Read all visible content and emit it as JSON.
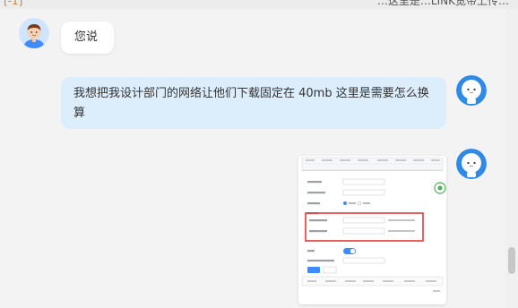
{
  "header": {
    "left_mark": "[-1]",
    "right_text": "…这里是…LINK宽带上传…"
  },
  "messages": [
    {
      "sender": "user",
      "text": "您说"
    },
    {
      "sender": "bot",
      "text": "我想把我设计部门的网络让他们下载固定在 40mb 这里是需要怎么换算"
    },
    {
      "sender": "bot",
      "type": "image",
      "content": "router-settings-screenshot"
    }
  ],
  "colors": {
    "background": "#f3f3f3",
    "bubble_white": "#ffffff",
    "bubble_blue": "#dcedfb",
    "highlight_red": "#e53935",
    "accent_blue": "#3d8bfd"
  }
}
